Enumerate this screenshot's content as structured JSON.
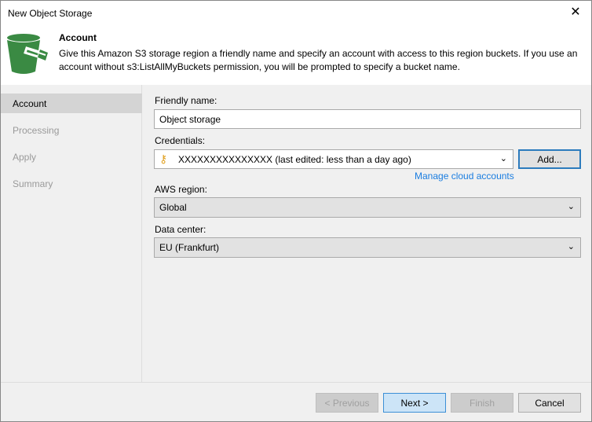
{
  "window": {
    "title": "New Object Storage"
  },
  "header": {
    "title": "Account",
    "description": "Give this Amazon S3 storage region a friendly name and specify an account with access to this region buckets. If you use an account without s3:ListAllMyBuckets permission, you will be prompted to specify a bucket name."
  },
  "sidebar": {
    "items": [
      {
        "label": "Account"
      },
      {
        "label": "Processing"
      },
      {
        "label": "Apply"
      },
      {
        "label": "Summary"
      }
    ]
  },
  "form": {
    "friendly_name_label": "Friendly name:",
    "friendly_name_value": "Object storage",
    "credentials_label": "Credentials:",
    "credentials_value": "XXXXXXXXXXXXXXX (last edited: less than a day ago)",
    "add_label": "Add...",
    "manage_link": "Manage cloud accounts",
    "region_label": "AWS region:",
    "region_value": "Global",
    "datacenter_label": "Data center:",
    "datacenter_value": "EU (Frankfurt)"
  },
  "footer": {
    "previous": "< Previous",
    "next": "Next >",
    "finish": "Finish",
    "cancel": "Cancel"
  }
}
